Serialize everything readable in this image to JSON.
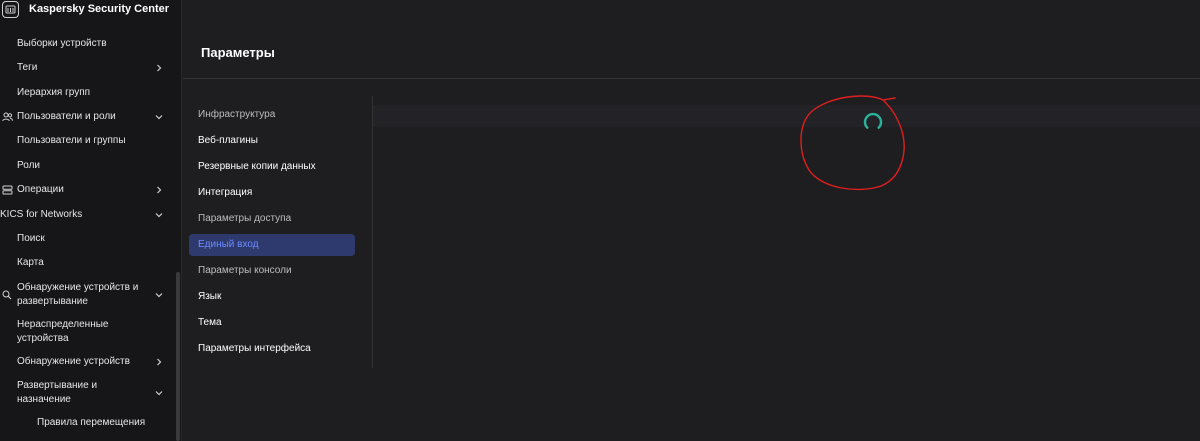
{
  "app": {
    "title": "Kaspersky Security Center"
  },
  "sidebar": {
    "items": [
      {
        "label": "Выборки устройств"
      },
      {
        "label": "Теги"
      },
      {
        "label": "Иерархия групп"
      },
      {
        "label": "Пользователи и роли"
      },
      {
        "label": "Пользователи и группы"
      },
      {
        "label": "Роли"
      },
      {
        "label": "Операции"
      },
      {
        "label": "KICS for Networks"
      },
      {
        "label": "Поиск"
      },
      {
        "label": "Карта"
      },
      {
        "label": "Обнаружение устройств и развертывание"
      },
      {
        "label": "Нераспределенные устройства"
      },
      {
        "label": "Обнаружение устройств"
      },
      {
        "label": "Развертывание и назначение"
      },
      {
        "label": "Правила перемещения"
      }
    ]
  },
  "page": {
    "title": "Параметры"
  },
  "settings_nav": {
    "items": [
      {
        "label": "Инфраструктура"
      },
      {
        "label": "Веб-плагины"
      },
      {
        "label": "Резервные копии данных"
      },
      {
        "label": "Интеграция"
      },
      {
        "label": "Параметры доступа"
      },
      {
        "label": "Единый вход"
      },
      {
        "label": "Параметры консоли"
      },
      {
        "label": "Язык"
      },
      {
        "label": "Тема"
      },
      {
        "label": "Параметры интерфейса"
      }
    ],
    "active": "Единый вход"
  },
  "colors": {
    "accent": "#6d8cff",
    "active_bg": "#2e3a6e",
    "spinner": "#2bb39a",
    "annotation": "#e01e1e"
  },
  "icons": [
    "app-logo-icon",
    "users-icon",
    "operations-icon",
    "search-icon",
    "chevron-right-icon",
    "chevron-down-icon",
    "loading-spinner-icon"
  ]
}
